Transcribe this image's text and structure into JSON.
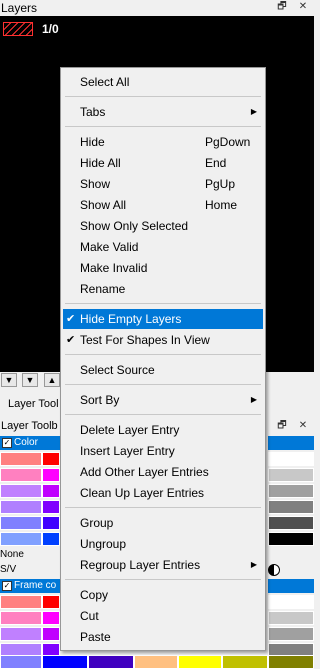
{
  "panel": {
    "title": "Layers",
    "layer_count": "1/0",
    "toolbox_tab": "Layer Tool",
    "toolbox_title": "Layer Toolb"
  },
  "palette": {
    "row1_label": "Color",
    "row2_label": "Frame co",
    "none_label": "None",
    "sv_label": "S/V"
  },
  "menu": {
    "select_all": "Select All",
    "tabs": "Tabs",
    "hide": "Hide",
    "hide_key": "PgDown",
    "hide_all": "Hide All",
    "hide_all_key": "End",
    "show": "Show",
    "show_key": "PgUp",
    "show_all": "Show All",
    "show_all_key": "Home",
    "show_only_selected": "Show Only Selected",
    "make_valid": "Make Valid",
    "make_invalid": "Make Invalid",
    "rename": "Rename",
    "hide_empty_layers": "Hide Empty Layers",
    "test_for_shapes": "Test For Shapes In View",
    "select_source": "Select Source",
    "sort_by": "Sort By",
    "delete_layer_entry": "Delete Layer Entry",
    "insert_layer_entry": "Insert Layer Entry",
    "add_other_layer_entries": "Add Other Layer Entries",
    "clean_up_layer_entries": "Clean Up Layer Entries",
    "group": "Group",
    "ungroup": "Ungroup",
    "regroup_layer_entries": "Regroup Layer Entries",
    "copy": "Copy",
    "cut": "Cut",
    "paste": "Paste"
  },
  "colors": {
    "accent": "#0078d7",
    "canvas": "#000000",
    "menu_bg": "#f0f0f0"
  }
}
